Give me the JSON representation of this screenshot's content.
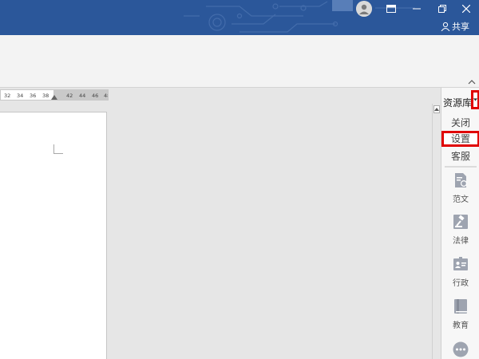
{
  "titlebar": {
    "share_label": "共享",
    "accent_color": "#2b579a"
  },
  "ruler": {
    "ticks": [
      "32",
      "34",
      "36",
      "38",
      "42",
      "44",
      "46",
      "48"
    ]
  },
  "panel": {
    "title": "资源库",
    "menu": [
      "关闭",
      "设置",
      "客服"
    ],
    "highlighted_item": "设置",
    "categories": [
      {
        "label": "范文",
        "icon": "document-icon"
      },
      {
        "label": "法律",
        "icon": "gavel-icon"
      },
      {
        "label": "行政",
        "icon": "id-card-icon"
      },
      {
        "label": "教育",
        "icon": "book-icon"
      },
      {
        "label": "",
        "icon": "more-icon"
      }
    ],
    "highlight_color": "#e00000"
  }
}
